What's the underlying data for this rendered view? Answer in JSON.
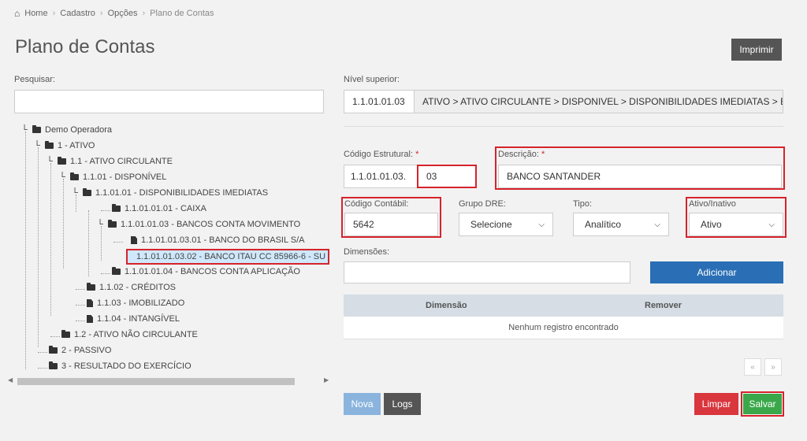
{
  "breadcrumb": {
    "home": "Home",
    "items": [
      "Cadastro",
      "Opções"
    ],
    "current": "Plano de Contas"
  },
  "page": {
    "title": "Plano de Contas",
    "print_label": "Imprimir"
  },
  "search": {
    "label": "Pesquisar:",
    "value": ""
  },
  "nivel": {
    "label": "Nível superior:",
    "code": "1.1.01.01.03",
    "path": "ATIVO > ATIVO CIRCULANTE > DISPONIVEL > DISPONIBILIDADES IMEDIATAS > E"
  },
  "codigo_estrutural": {
    "label": "Código Estrutural:",
    "required": "*",
    "prefix": "1.1.01.01.03.",
    "value": "03"
  },
  "descricao": {
    "label": "Descrição:",
    "required": "*",
    "value": "BANCO SANTANDER"
  },
  "codigo_contabil": {
    "label": "Código Contábil:",
    "value": "5642"
  },
  "grupo_dre": {
    "label": "Grupo DRE:",
    "selected": "Selecione"
  },
  "tipo": {
    "label": "Tipo:",
    "selected": "Analítico"
  },
  "ativo": {
    "label": "Ativo/Inativo",
    "selected": "Ativo"
  },
  "dimensoes": {
    "label": "Dimensões:",
    "value": "",
    "add_label": "Adicionar"
  },
  "table": {
    "columns": [
      "Dimensão",
      "Remover"
    ],
    "empty": "Nenhum registro encontrado"
  },
  "pager": {
    "prev": "«",
    "next": "»"
  },
  "actions": {
    "nova": "Nova",
    "logs": "Logs",
    "limpar": "Limpar",
    "salvar": "Salvar"
  },
  "tree": [
    {
      "label": "Demo Operadora",
      "kind": "folder"
    },
    {
      "label": "1 - ATIVO",
      "kind": "folder"
    },
    {
      "label": "1.1 - ATIVO CIRCULANTE",
      "kind": "folder"
    },
    {
      "label": "1.1.01 - DISPONÍVEL",
      "kind": "folder"
    },
    {
      "label": "1.1.01.01 - DISPONIBILIDADES IMEDIATAS",
      "kind": "folder"
    },
    {
      "label": "1.1.01.01.01 - CAIXA",
      "kind": "folder"
    },
    {
      "label": "1.1.01.01.03 - BANCOS CONTA MOVIMENTO",
      "kind": "folder"
    },
    {
      "label": "1.1.01.01.03.01 - BANCO DO BRASIL S/A",
      "kind": "file"
    },
    {
      "label": "1.1.01.01.03.02 - BANCO ITAU CC 85966-6 - SU",
      "kind": "file",
      "selected": true
    },
    {
      "label": "1.1.01.01.04 - BANCOS CONTA APLICAÇÃO",
      "kind": "folder"
    },
    {
      "label": "1.1.02 - CRÉDITOS",
      "kind": "folder"
    },
    {
      "label": "1.1.03 - IMOBILIZADO",
      "kind": "file"
    },
    {
      "label": "1.1.04 - INTANGÍVEL",
      "kind": "file"
    },
    {
      "label": "1.2 - ATIVO NÃO CIRCULANTE",
      "kind": "folder"
    },
    {
      "label": "2 - PASSIVO",
      "kind": "folder"
    },
    {
      "label": "3 - RESULTADO DO EXERCÍCIO",
      "kind": "folder"
    }
  ],
  "colors": {
    "highlight": "#d6232b",
    "primary": "#2a6fb5",
    "danger": "#d9363e",
    "success": "#3aa84a",
    "nova": "#8ab4dd",
    "logs": "#555555",
    "selection": "#cfe8fb"
  }
}
